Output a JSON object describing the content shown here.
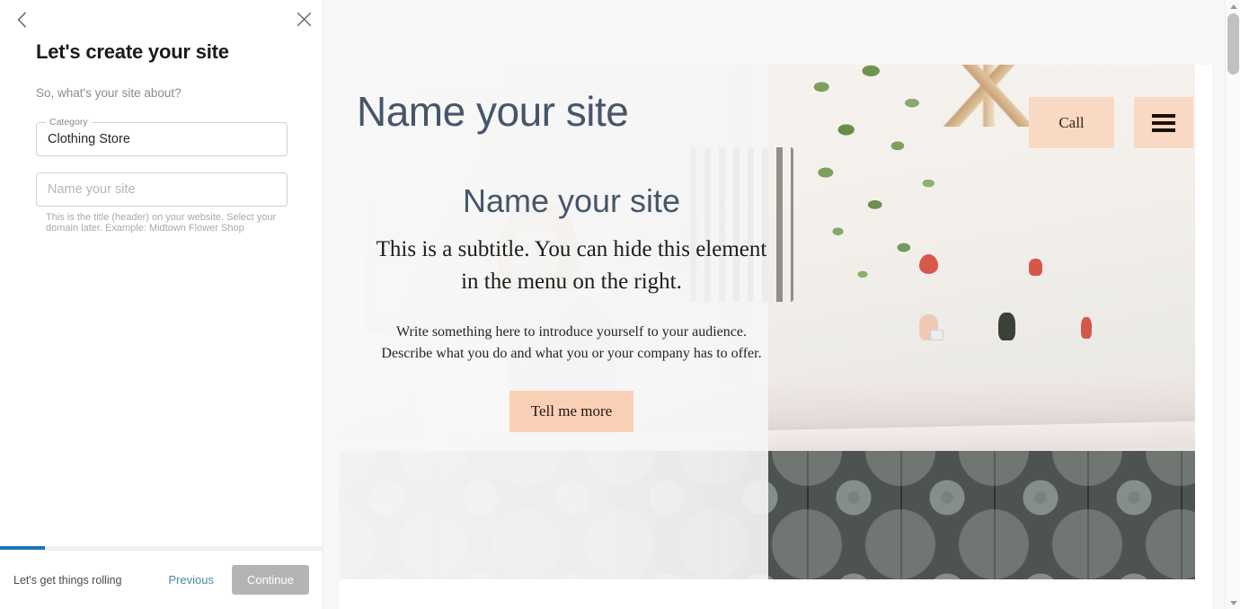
{
  "wizard": {
    "back_icon": "chevron-left-icon",
    "close_icon": "close-icon",
    "title": "Let's create your site",
    "subtitle": "So, what's your site about?",
    "category_field": {
      "label": "Category",
      "value": "Clothing Store",
      "placeholder": ""
    },
    "name_field": {
      "label": "",
      "value": "",
      "placeholder": "Name your site",
      "helper_text": "This is the title (header) on your website. Select your domain later. Example: Midtown Flower Shop"
    },
    "progress": {
      "percent": 14,
      "color": "#2075b8"
    },
    "footer": {
      "note": "Let's get things rolling",
      "previous_label": "Previous",
      "previous_color": "#4a8aa8",
      "continue_label": "Continue",
      "continue_color": "#b4b4b4",
      "continue_disabled": true
    }
  },
  "preview": {
    "site_title": "Name your site",
    "nav": {
      "call_label": "Call",
      "menu_icon": "hamburger-menu-icon",
      "button_color": "#f9d8c4"
    },
    "hero": {
      "heading": "Name your site",
      "heading_color": "#46566a",
      "subtitle": "This is a subtitle. You can hide this element in the menu on the right.",
      "paragraph": "Write something here to introduce yourself to your audience. Describe what you do and what you or your company has to offer.",
      "cta_label": "Tell me more",
      "cta_color": "#f9d0b5"
    },
    "background_image_alt": "Woman working on a tablet at a white boutique shop counter with hanging plants and clothing on the wall"
  },
  "scrollbars": {
    "inner_up_icon": "scroll-up-arrow-icon",
    "inner_down_icon": "scroll-down-arrow-icon",
    "browser_up_icon": "scroll-up-arrow-icon",
    "browser_down_icon": "scroll-down-arrow-icon"
  }
}
